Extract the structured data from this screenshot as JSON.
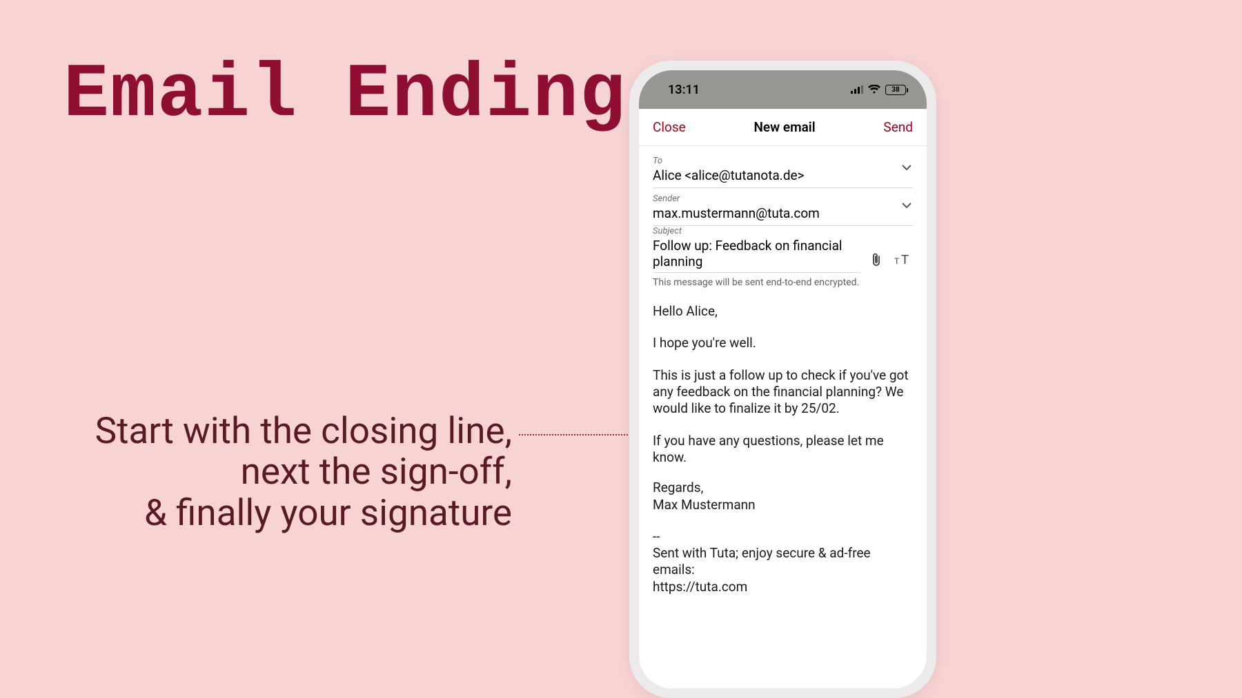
{
  "slide": {
    "title": "Email Ending",
    "caption_line1": "Start with the closing line,",
    "caption_line2": "next the sign-off,",
    "caption_line3": "& finally your signature"
  },
  "phone": {
    "status": {
      "time": "13:11",
      "battery": "38"
    },
    "header": {
      "close": "Close",
      "title": "New email",
      "send": "Send"
    },
    "fields": {
      "to_label": "To",
      "to_value": "Alice <alice@tutanota.de>",
      "sender_label": "Sender",
      "sender_value": "max.mustermann@tuta.com",
      "subject_label": "Subject",
      "subject_value": "Follow up: Feedback on financial planning",
      "encryption_note": "This message will be sent end-to-end encrypted."
    },
    "body": {
      "greeting": "Hello Alice,",
      "line1": "I hope you're well.",
      "line2": "This is just a follow up to check if you've got any feedback on the financial planning? We would like to finalize it by 25/02.",
      "closing": "If you have any questions, please let me know.",
      "signoff": "Regards,",
      "name": "Max Mustermann",
      "sig_sep": "--",
      "sig1": "Sent with Tuta; enjoy secure & ad-free emails:",
      "sig2": "https://tuta.com"
    }
  }
}
